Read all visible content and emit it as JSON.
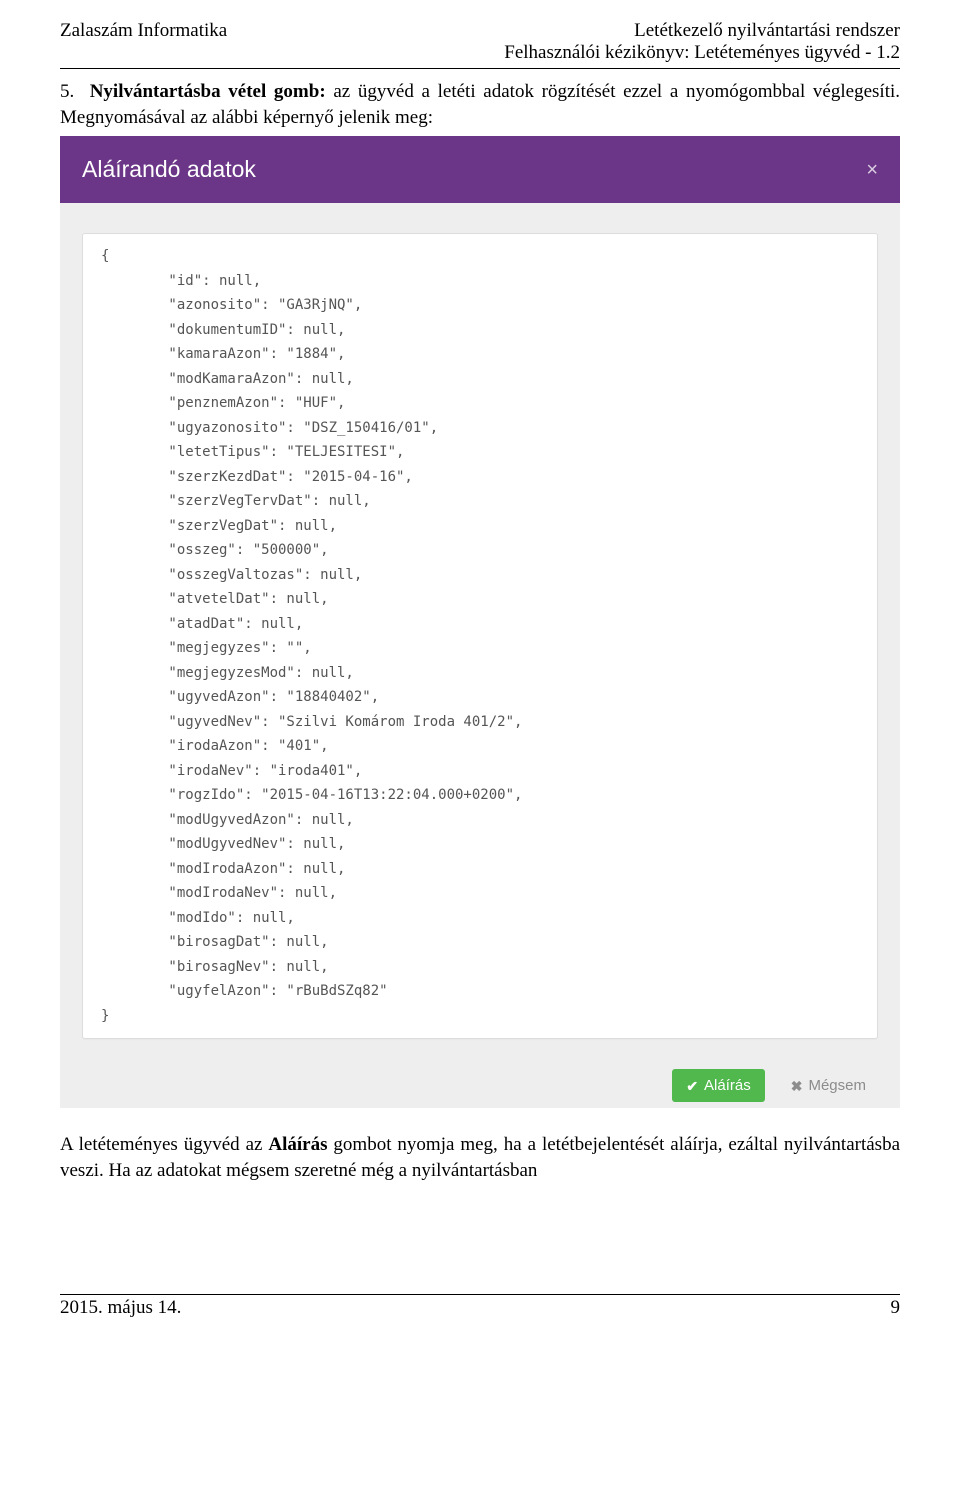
{
  "header": {
    "left": "Zalaszám Informatika",
    "right_line1": "Letétkezelő nyilvántartási rendszer",
    "right_line2": "Felhasználói kézikönyv: Letéteményes ügyvéd - 1.2"
  },
  "section": {
    "number": "5.",
    "lead_bold": "Nyilvántartásba vétel gomb:",
    "lead_rest": " az ügyvéd a letéti adatok rögzítését ezzel a nyomógombbal véglegesíti. Megnyomásával az alábbi képernyő jelenik meg:"
  },
  "modal": {
    "title": "Aláírandó adatok",
    "close_symbol": "×",
    "json_text": "{\n        \"id\": null,\n        \"azonosito\": \"GA3RjNQ\",\n        \"dokumentumID\": null,\n        \"kamaraAzon\": \"1884\",\n        \"modKamaraAzon\": null,\n        \"penznemAzon\": \"HUF\",\n        \"ugyazonosito\": \"DSZ_150416/01\",\n        \"letetTipus\": \"TELJESITESI\",\n        \"szerzKezdDat\": \"2015-04-16\",\n        \"szerzVegTervDat\": null,\n        \"szerzVegDat\": null,\n        \"osszeg\": \"500000\",\n        \"osszegValtozas\": null,\n        \"atvetelDat\": null,\n        \"atadDat\": null,\n        \"megjegyzes\": \"\",\n        \"megjegyzesMod\": null,\n        \"ugyvedAzon\": \"18840402\",\n        \"ugyvedNev\": \"Szilvi Komárom Iroda 401/2\",\n        \"irodaAzon\": \"401\",\n        \"irodaNev\": \"iroda401\",\n        \"rogzIdo\": \"2015-04-16T13:22:04.000+0200\",\n        \"modUgyvedAzon\": null,\n        \"modUgyvedNev\": null,\n        \"modIrodaAzon\": null,\n        \"modIrodaNev\": null,\n        \"modIdo\": null,\n        \"birosagDat\": null,\n        \"birosagNev\": null,\n        \"ugyfelAzon\": \"rBuBdSZq82\"\n}",
    "btn_sign": "Aláírás",
    "btn_cancel": "Mégsem"
  },
  "after_text": {
    "part1": "A letéteményes ügyvéd az ",
    "bold": "Aláírás",
    "part2": " gombot nyomja meg, ha a letétbejelentését aláírja, ezáltal nyilvántartásba veszi. Ha az adatokat mégsem szeretné még a nyilvántartásban"
  },
  "footer": {
    "left": "2015. május 14.",
    "right": "9"
  }
}
